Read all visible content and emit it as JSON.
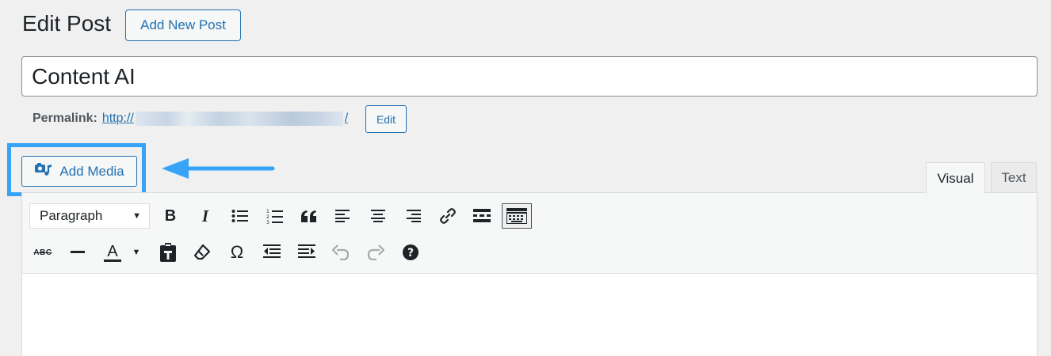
{
  "header": {
    "title": "Edit Post",
    "add_new_label": "Add New Post"
  },
  "post": {
    "title_value": "Content AI"
  },
  "permalink": {
    "label": "Permalink:",
    "url_start": "http://",
    "url_end": "/",
    "edit_label": "Edit"
  },
  "media": {
    "add_media_label": "Add Media"
  },
  "editor_tabs": {
    "visual": "Visual",
    "text": "Text"
  },
  "toolbar": {
    "format_value": "Paragraph",
    "row1": [
      "bold-icon",
      "italic-icon",
      "bulleted-list-icon",
      "numbered-list-icon",
      "blockquote-icon",
      "align-left-icon",
      "align-center-icon",
      "align-right-icon",
      "insert-link-icon",
      "read-more-icon",
      "toolbar-toggle-icon"
    ],
    "row2": [
      "strikethrough-icon",
      "horizontal-line-icon",
      "text-color-icon",
      "paste-as-text-icon",
      "clear-formatting-icon",
      "special-character-icon",
      "decrease-indent-icon",
      "increase-indent-icon",
      "undo-icon",
      "redo-icon",
      "help-icon"
    ],
    "bold": "B",
    "italic": "I",
    "strike": "ABC",
    "text_color": "A",
    "omega": "Ω"
  },
  "colors": {
    "accent": "#2271b1",
    "highlight": "#36a3f7",
    "background": "#f0f0f1"
  }
}
